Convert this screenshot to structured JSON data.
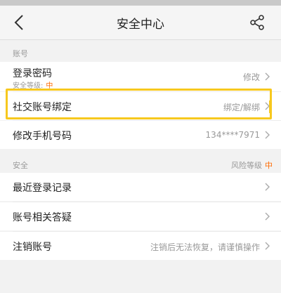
{
  "status_bar": {
    "text": ""
  },
  "nav": {
    "title": "安全中心",
    "back_icon": "back-arrow-icon",
    "share_icon": "share-icon"
  },
  "sections": {
    "account": {
      "header": "账号",
      "rows": [
        {
          "label": "登录密码",
          "sub_label": "安全等级:",
          "sub_level": "中",
          "value": "修改"
        },
        {
          "label": "社交账号绑定",
          "value": "绑定/解绑"
        },
        {
          "label": "修改手机号码",
          "value": "134****7971"
        }
      ]
    },
    "security": {
      "header": "安全",
      "risk_label": "风险等级",
      "risk_level": "中",
      "rows": [
        {
          "label": "最近登录记录",
          "value": ""
        },
        {
          "label": "账号相关答疑",
          "value": ""
        },
        {
          "label": "注销账号",
          "value": "注销后无法恢复，请谨慎操作"
        }
      ]
    }
  },
  "colors": {
    "accent_orange": "#ff6a00",
    "highlight_yellow": "#f7c81e",
    "background": "#f2f2f2"
  }
}
